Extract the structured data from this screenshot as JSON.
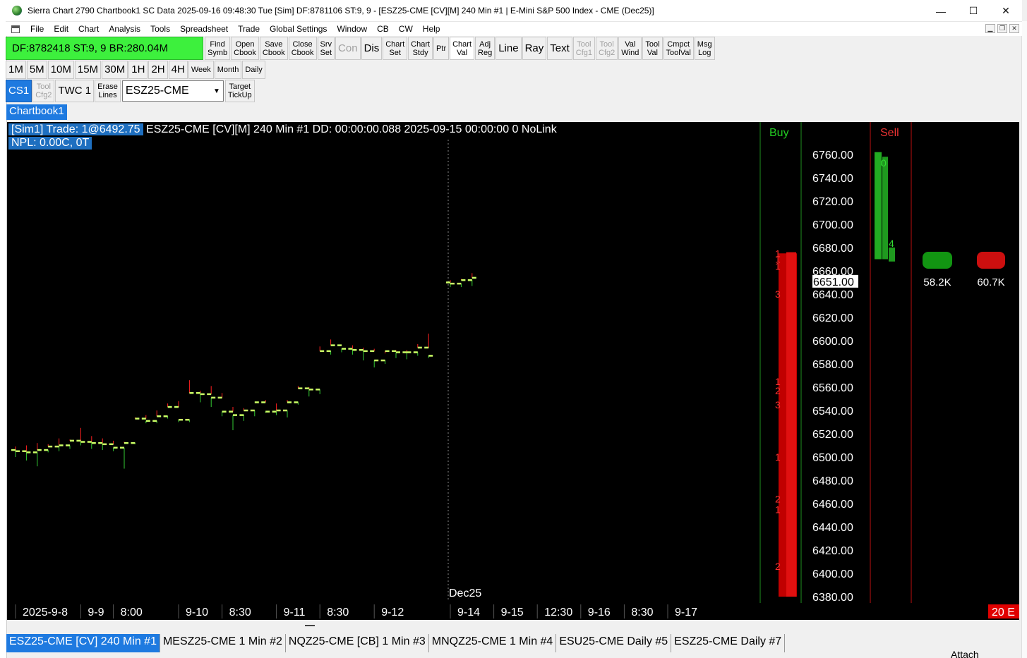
{
  "window": {
    "title": "Sierra Chart 2790 Chartbook1 SC Data 2025-09-16  09:48:30 Tue [Sim] DF:8781106  ST:9, 9 - [ESZ25-CME [CV][M]  240 Min  #1 | E-Mini S&P 500 Index - CME (Dec25)]",
    "minimize": "—",
    "maximize": "☐",
    "close": "✕"
  },
  "menu": [
    "File",
    "Edit",
    "Chart",
    "Analysis",
    "Tools",
    "Spreadsheet",
    "Trade",
    "Global Settings",
    "Window",
    "CB",
    "CW",
    "Help"
  ],
  "toolbar1": {
    "status": "DF:8782418  ST:9, 9   BR:280.04M",
    "buttons": [
      {
        "l1": "Find",
        "l2": "Symb"
      },
      {
        "l1": "Open",
        "l2": "Cbook"
      },
      {
        "l1": "Save",
        "l2": "Cbook"
      },
      {
        "l1": "Close",
        "l2": "Cbook"
      },
      {
        "l1": "Srv",
        "l2": "Set"
      }
    ],
    "con": "Con",
    "dis": "Dis",
    "buttons2": [
      {
        "l1": "Chart",
        "l2": "Set"
      },
      {
        "l1": "Chart",
        "l2": "Stdy"
      }
    ],
    "ptr": "Ptr",
    "buttons3": [
      {
        "l1": "Chart",
        "l2": "Val"
      },
      {
        "l1": "Adj",
        "l2": "Reg"
      }
    ],
    "line": "Line",
    "ray": "Ray",
    "text": "Text",
    "buttons4": [
      {
        "l1": "Tool",
        "l2": "Cfg1"
      },
      {
        "l1": "Tool",
        "l2": "Cfg2"
      },
      {
        "l1": "Val",
        "l2": "Wind"
      },
      {
        "l1": "Tool",
        "l2": "Val"
      },
      {
        "l1": "Cmpct",
        "l2": "ToolVal"
      },
      {
        "l1": "Msg",
        "l2": "Log"
      }
    ]
  },
  "toolbar2": [
    "1M",
    "5M",
    "10M",
    "15M",
    "30M",
    "1H",
    "2H",
    "4H",
    "Week",
    "Month",
    "Daily"
  ],
  "toolbar3": {
    "cs1": "CS1",
    "toolcfg2": {
      "l1": "Tool",
      "l2": "Cfg2"
    },
    "twc": "TWC 1",
    "erase": {
      "l1": "Erase",
      "l2": "Lines"
    },
    "symbol": "ESZ25-CME",
    "target": {
      "l1": "Target",
      "l2": "TickUp"
    }
  },
  "chartbook_tab": "Chartbook1",
  "chart": {
    "header_sim": "[Sim1]  Trade:  1@6492.75",
    "header_rest": "ESZ25-CME [CV][M]  240 Min  #1 DD: 00:00:00.088 2025-09-15 00:00:00 0 NoLink",
    "npl": "NPL: 0.00C, 0T",
    "contract_label": "Dec25",
    "buy_label": "Buy",
    "sell_label": "Sell",
    "buy_volume": "58.2K",
    "sell_volume": "60.7K",
    "current_price": "6651.00",
    "corner_badge": "20 E",
    "dom_numbers": [
      "1",
      "1",
      "1",
      "3",
      "1",
      "2",
      "3",
      "1",
      "2",
      "1",
      "2"
    ],
    "sell_top_number": "0",
    "sell_low_number": "4",
    "colors": {
      "up_bar": "#ccff66",
      "down_bar": "#ff2020",
      "buy": "#22bb22",
      "sell": "#dd1111"
    }
  },
  "chart_data": {
    "type": "bar",
    "title": "ESZ25-CME [CV][M]  240 Min  #1",
    "ylabel": "",
    "xlabel": "",
    "ylim": [
      6380,
      6770
    ],
    "y_ticks": [
      6760,
      6740,
      6720,
      6700,
      6680,
      6660,
      6640,
      6620,
      6600,
      6580,
      6560,
      6540,
      6520,
      6500,
      6480,
      6460,
      6440,
      6420,
      6400,
      6380
    ],
    "x_ticks": [
      {
        "label": "2025-9-8",
        "bar": 0
      },
      {
        "label": "9-9",
        "bar": 6
      },
      {
        "label": "8:00",
        "bar": 9
      },
      {
        "label": "9-10",
        "bar": 15
      },
      {
        "label": "8:30",
        "bar": 19
      },
      {
        "label": "9-11",
        "bar": 24
      },
      {
        "label": "8:30",
        "bar": 28
      },
      {
        "label": "9-12",
        "bar": 33
      },
      {
        "label": "9-14",
        "bar": 40
      },
      {
        "label": "9-15",
        "bar": 44
      },
      {
        "label": "12:30",
        "bar": 48
      },
      {
        "label": "9-16",
        "bar": 52
      },
      {
        "label": "8:30",
        "bar": 56
      },
      {
        "label": "9-17",
        "bar": 60
      }
    ],
    "series": [
      {
        "ohlc": [
          [
            6506,
            6509,
            6500,
            6505
          ],
          [
            6505,
            6510,
            6497,
            6504
          ],
          [
            6504,
            6512,
            6492,
            6506
          ],
          [
            6506,
            6511,
            6504,
            6509
          ],
          [
            6509,
            6516,
            6505,
            6510
          ],
          [
            6510,
            6515,
            6507,
            6514
          ],
          [
            6514,
            6525,
            6510,
            6513
          ],
          [
            6513,
            6518,
            6507,
            6512
          ],
          [
            6512,
            6516,
            6506,
            6511
          ],
          [
            6511,
            6514,
            6505,
            6508
          ],
          [
            6508,
            6513,
            6490,
            6512
          ],
          [
            6512,
            6534,
            6511,
            6533
          ],
          [
            6533,
            6536,
            6529,
            6531
          ],
          [
            6531,
            6540,
            6529,
            6535
          ],
          [
            6535,
            6546,
            6533,
            6543
          ],
          [
            6543,
            6548,
            6530,
            6532
          ],
          [
            6532,
            6566,
            6530,
            6555
          ],
          [
            6555,
            6557,
            6547,
            6554
          ],
          [
            6554,
            6561,
            6543,
            6551
          ],
          [
            6551,
            6555,
            6535,
            6539
          ],
          [
            6539,
            6543,
            6523,
            6536
          ],
          [
            6536,
            6542,
            6531,
            6540
          ],
          [
            6540,
            6547,
            6535,
            6547
          ],
          [
            6547,
            6549,
            6538,
            6539
          ],
          [
            6539,
            6546,
            6536,
            6540
          ],
          [
            6540,
            6549,
            6534,
            6547
          ],
          [
            6547,
            6561,
            6545,
            6559
          ],
          [
            6559,
            6560,
            6552,
            6558
          ],
          [
            6558,
            6595,
            6554,
            6591
          ],
          [
            6591,
            6601,
            6588,
            6596
          ],
          [
            6596,
            6596,
            6590,
            6593
          ],
          [
            6593,
            6596,
            6588,
            6592
          ],
          [
            6592,
            6594,
            6583,
            6591
          ],
          [
            6591,
            6593,
            6577,
            6583
          ],
          [
            6583,
            6589,
            6580,
            6591
          ],
          [
            6591,
            6592,
            6585,
            6590
          ],
          [
            6590,
            6592,
            6584,
            6590
          ],
          [
            6590,
            6597,
            6587,
            6594
          ],
          [
            6594,
            6606,
            6585,
            6587
          ],
          null,
          [
            6650,
            6652,
            6646,
            6649
          ],
          [
            6649,
            6653,
            6646,
            6652
          ],
          [
            6652,
            6658,
            6647,
            6654
          ]
        ]
      }
    ],
    "current_price": 6651
  }
}
